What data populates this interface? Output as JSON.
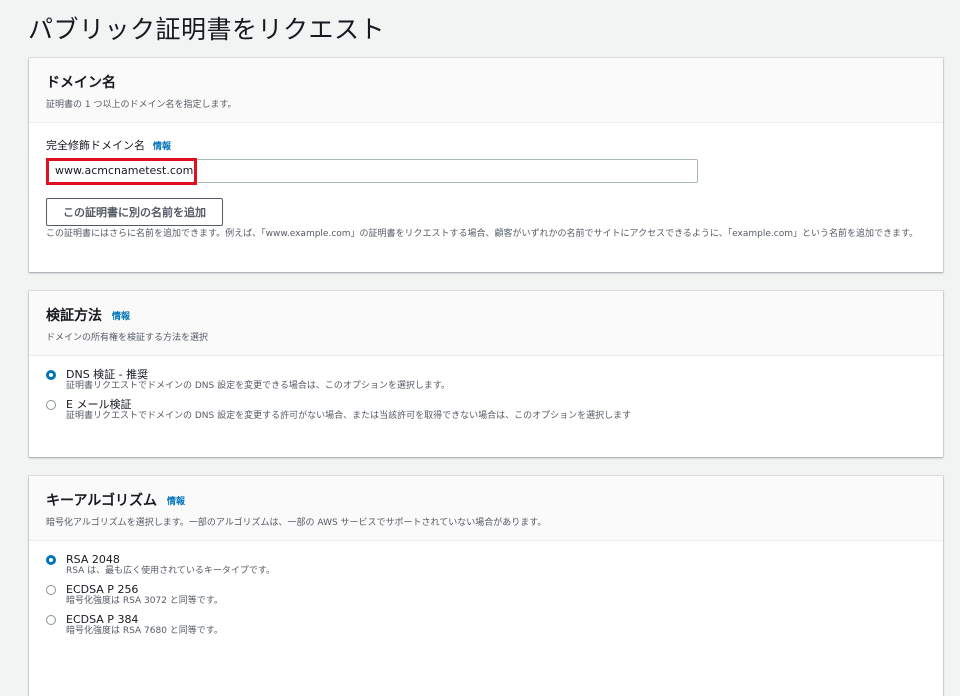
{
  "page": {
    "title": "パブリック証明書をリクエスト"
  },
  "domain_panel": {
    "title": "ドメイン名",
    "description": "証明書の 1 つ以上のドメイン名を指定します。",
    "field_label": "完全修飾ドメイン名",
    "info_label": "情報",
    "input_value": "www.acmcnametest.com",
    "add_button": "この証明書に別の名前を追加",
    "help_text": "この証明書にはさらに名前を追加できます。例えば、「www.example.com」の証明書をリクエストする場合、顧客がいずれかの名前でサイトにアクセスできるように、「example.com」という名前を追加できます。"
  },
  "validation_panel": {
    "title": "検証方法",
    "info_label": "情報",
    "description": "ドメインの所有権を検証する方法を選択",
    "options": [
      {
        "label": "DNS 検証 - 推奨",
        "desc": "証明書リクエストでドメインの DNS 設定を変更できる場合は、このオプションを選択します。",
        "checked": true
      },
      {
        "label": "E メール検証",
        "desc": "証明書リクエストでドメインの DNS 設定を変更する許可がない場合、または当該許可を取得できない場合は、このオプションを選択します",
        "checked": false
      }
    ]
  },
  "algorithm_panel": {
    "title": "キーアルゴリズム",
    "info_label": "情報",
    "description": "暗号化アルゴリズムを選択します。一部のアルゴリズムは、一部の AWS サービスでサポートされていない場合があります。",
    "options": [
      {
        "label": "RSA 2048",
        "desc": "RSA は、最も広く使用されているキータイプです。",
        "checked": true
      },
      {
        "label": "ECDSA P 256",
        "desc": "暗号化強度は RSA 3072 と同等です。",
        "checked": false
      },
      {
        "label": "ECDSA P 384",
        "desc": "暗号化強度は RSA 7680 と同等です。",
        "checked": false
      }
    ]
  },
  "colors": {
    "accent": "#0073bb",
    "highlight": "#e01020",
    "background": "#f2f3f3"
  }
}
